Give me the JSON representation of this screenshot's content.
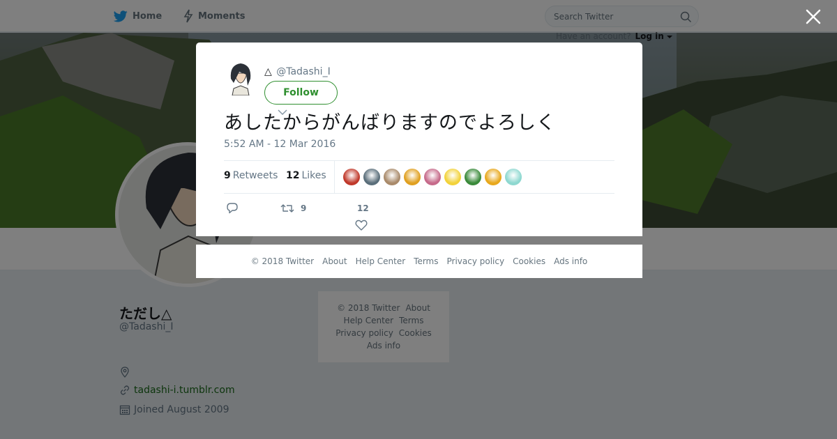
{
  "nav": {
    "home_label": "Home",
    "moments_label": "Moments"
  },
  "search": {
    "placeholder": "Search Twitter"
  },
  "account": {
    "prompt": "Have an account?",
    "login_label": "Log in"
  },
  "profile": {
    "name": "ただし△",
    "handle": "@Tadashi_I",
    "url": "tadashi-i.tumblr.com",
    "joined": "Joined August 2009"
  },
  "side_footer": {
    "copyright": "© 2018 Twitter",
    "about": "About",
    "help": "Help Center",
    "terms": "Terms",
    "privacy": "Privacy policy",
    "cookies": "Cookies",
    "ads": "Ads info"
  },
  "tweet": {
    "author_name": "△",
    "author_handle": "@Tadashi_I",
    "follow_label": "Follow",
    "text": "あしたからがんばりますのでよろしく",
    "timestamp": "5:52 AM - 12 Mar 2016",
    "retweets_count": "9",
    "retweets_label": "Retweets",
    "likes_count": "12",
    "likes_label": "Likes",
    "action_retweet_count": "9",
    "action_like_count": "12",
    "likers": [
      {
        "color": "#c0392b"
      },
      {
        "color": "#5a6e7a"
      },
      {
        "color": "#a98a6a"
      },
      {
        "color": "#e0a020"
      },
      {
        "color": "#c66a8a"
      },
      {
        "color": "#f2d23a"
      },
      {
        "color": "#3a8a3a"
      },
      {
        "color": "#e8a81c"
      },
      {
        "color": "#8ed8d0"
      }
    ]
  },
  "modal_footer": {
    "copyright": "© 2018 Twitter",
    "about": "About",
    "help": "Help Center",
    "terms": "Terms",
    "privacy": "Privacy policy",
    "cookies": "Cookies",
    "ads": "Ads info"
  },
  "colors": {
    "accent": "#2f8f2f",
    "brand": "#1da1f2"
  }
}
